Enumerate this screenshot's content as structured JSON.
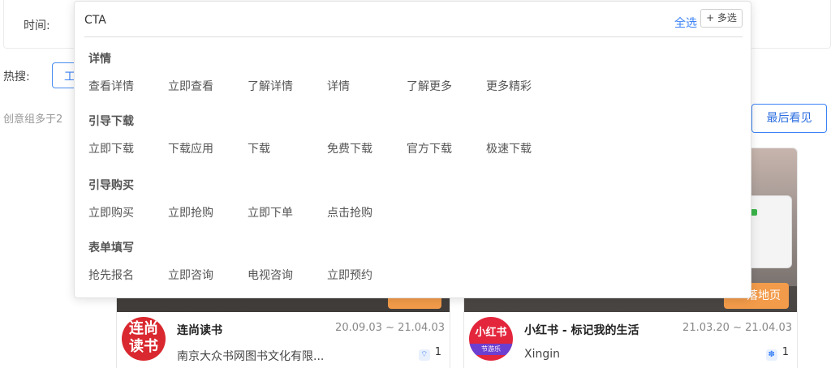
{
  "filter": {
    "time_label": "时间:"
  },
  "hot_search": {
    "label": "热搜:",
    "tag": "工"
  },
  "count_text": "创意组多于2",
  "last_seen_button": "最后看见",
  "cards": [
    {
      "landing_button": "",
      "logo_text": [
        "连尚",
        "读书"
      ],
      "app_name": "连尚读书",
      "dates": "20.09.03 ~ 21.04.03",
      "company": "南京大众书网图书文化有限...",
      "count": "1",
      "icon": "wifi-icon"
    },
    {
      "landing_button": "落地页",
      "logo_text": [
        "小红书",
        "节游乐"
      ],
      "app_name": "小红书 - 标记我的生活",
      "dates": "21.03.20 ~ 21.04.03",
      "company": "Xingin",
      "count": "1",
      "icon": "paw-icon"
    }
  ],
  "cta_panel": {
    "title": "CTA",
    "select_all": "全选",
    "multi_select": "+ 多选",
    "groups": [
      {
        "title": "详情",
        "items": [
          "查看详情",
          "立即查看",
          "了解详情",
          "详情",
          "了解更多",
          "更多精彩"
        ]
      },
      {
        "title": "引导下载",
        "items": [
          "立即下载",
          "下载应用",
          "下载",
          "免费下载",
          "官方下载",
          "极速下载"
        ]
      },
      {
        "title": "引导购买",
        "items": [
          "立即购买",
          "立即抢购",
          "立即下单",
          "点击抢购"
        ]
      },
      {
        "title": "表单填写",
        "items": [
          "抢先报名",
          "立即咨询",
          "电视咨询",
          "立即预约"
        ]
      }
    ]
  },
  "colors": {
    "accent": "#3b82f6",
    "landing_orange": "#f29b4a"
  }
}
